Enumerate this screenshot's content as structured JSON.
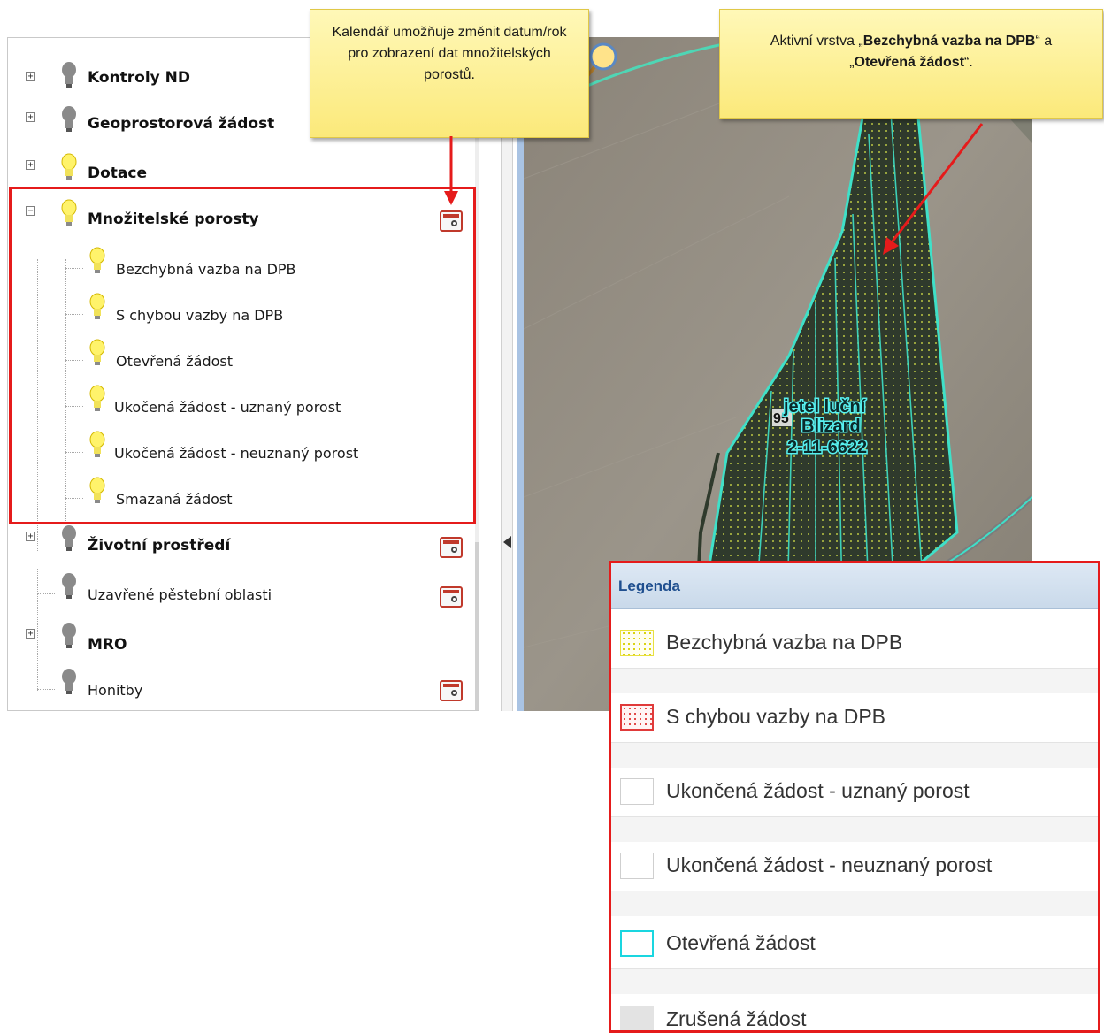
{
  "callouts": {
    "calendar": "Kalendář umožňuje změnit datum/rok pro zobrazení dat množitelských porostů.",
    "active_layer_prefix": "Aktivní vrstva „",
    "active_layer_1": "Bezchybná vazba na DPB",
    "active_layer_mid": "“ a „",
    "active_layer_2": "Otevřená žádost",
    "active_layer_suffix": "“."
  },
  "tree": {
    "groups": [
      {
        "label": "Kontroly ND",
        "expander": "+",
        "icon": "bulb-off-icon"
      },
      {
        "label": "Geoprostorová žádost",
        "expander": "+",
        "icon": "bulb-off-icon"
      },
      {
        "label": "Dotace",
        "expander": "+",
        "icon": "bulb-on-icon"
      },
      {
        "label": "Množitelské porosty",
        "expander": "−",
        "icon": "bulb-on-icon",
        "calendar": true
      },
      {
        "label": "Životní prostředí",
        "expander": "+",
        "icon": "bulb-off-icon",
        "calendar": true
      },
      {
        "label": "MRO",
        "expander": "+",
        "icon": "bulb-off-icon"
      }
    ],
    "children": [
      "Bezchybná vazba na DPB",
      "S chybou vazby na DPB",
      "Otevřená žádost",
      "Ukočená žádost - uznaný porost",
      "Ukočená žádost - neuznaný porost",
      "Smazaná žádost"
    ],
    "leaf_uzavrene": "Uzavřené pěstební oblasti",
    "leaf_honitby": "Honitby"
  },
  "map": {
    "parcel_label_line1": "jetel luční",
    "parcel_label_line2": "Blizard",
    "parcel_label_line3": "2-11-6622",
    "parcel_label_prefix": "95"
  },
  "legend": {
    "title": "Legenda",
    "items": [
      {
        "label": "Bezchybná vazba na DPB",
        "swatch": "yellow-dots"
      },
      {
        "label": "S chybou vazby na DPB",
        "swatch": "red-dots"
      },
      {
        "label": "Ukončená žádost - uznaný porost",
        "swatch": "empty"
      },
      {
        "label": "Ukončená žádost - neuznaný porost",
        "swatch": "empty"
      },
      {
        "label": "Otevřená žádost",
        "swatch": "cyan-outline"
      },
      {
        "label": "Zrušená žádost",
        "swatch": "grey-fill"
      }
    ]
  },
  "colors": {
    "highlight": "#e51b1b",
    "callout": "#fbe97a",
    "parcel_outline": "#3fe0c8",
    "legend_title": "#1f4f8f"
  }
}
